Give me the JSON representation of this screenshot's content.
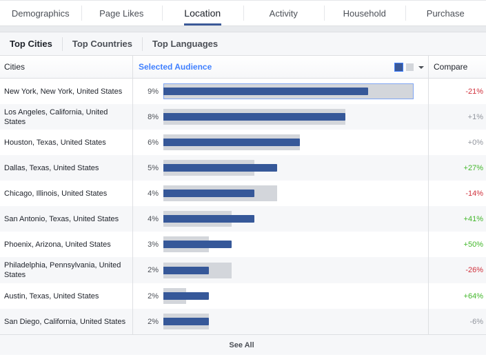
{
  "top_tabs": [
    {
      "label": "Demographics",
      "active": false
    },
    {
      "label": "Page Likes",
      "active": false
    },
    {
      "label": "Location",
      "active": true
    },
    {
      "label": "Activity",
      "active": false
    },
    {
      "label": "Household",
      "active": false
    },
    {
      "label": "Purchase",
      "active": false
    }
  ],
  "sub_tabs": [
    {
      "label": "Top Cities",
      "active": true
    },
    {
      "label": "Top Countries",
      "active": false
    },
    {
      "label": "Top Languages",
      "active": false
    }
  ],
  "table": {
    "headers": {
      "cities": "Cities",
      "selected_audience": "Selected Audience",
      "compare": "Compare"
    },
    "legend": {
      "selected_color": "#3b5998",
      "compare_color": "#d3d6db",
      "dropdown_icon": "caret-down-icon"
    },
    "rows": [
      {
        "city": "New York, New York, United States",
        "pct": "9%",
        "selected_value": 9,
        "compare_value": 11,
        "compare": "-21%",
        "trend": "neg",
        "highlighted": true
      },
      {
        "city": "Los Angeles, California, United States",
        "pct": "8%",
        "selected_value": 8,
        "compare_value": 8,
        "compare": "+1%",
        "trend": "neu"
      },
      {
        "city": "Houston, Texas, United States",
        "pct": "6%",
        "selected_value": 6,
        "compare_value": 6,
        "compare": "+0%",
        "trend": "neu"
      },
      {
        "city": "Dallas, Texas, United States",
        "pct": "5%",
        "selected_value": 5,
        "compare_value": 4,
        "compare": "+27%",
        "trend": "pos"
      },
      {
        "city": "Chicago, Illinois, United States",
        "pct": "4%",
        "selected_value": 4,
        "compare_value": 5,
        "compare": "-14%",
        "trend": "neg"
      },
      {
        "city": "San Antonio, Texas, United States",
        "pct": "4%",
        "selected_value": 4,
        "compare_value": 3,
        "compare": "+41%",
        "trend": "pos"
      },
      {
        "city": "Phoenix, Arizona, United States",
        "pct": "3%",
        "selected_value": 3,
        "compare_value": 2,
        "compare": "+50%",
        "trend": "pos"
      },
      {
        "city": "Philadelphia, Pennsylvania, United States",
        "pct": "2%",
        "selected_value": 2,
        "compare_value": 3,
        "compare": "-26%",
        "trend": "neg"
      },
      {
        "city": "Austin, Texas, United States",
        "pct": "2%",
        "selected_value": 2,
        "compare_value": 1,
        "compare": "+64%",
        "trend": "pos"
      },
      {
        "city": "San Diego, California, United States",
        "pct": "2%",
        "selected_value": 2,
        "compare_value": 2,
        "compare": "-6%",
        "trend": "neu"
      }
    ]
  },
  "footer": {
    "see_all": "See All"
  }
}
